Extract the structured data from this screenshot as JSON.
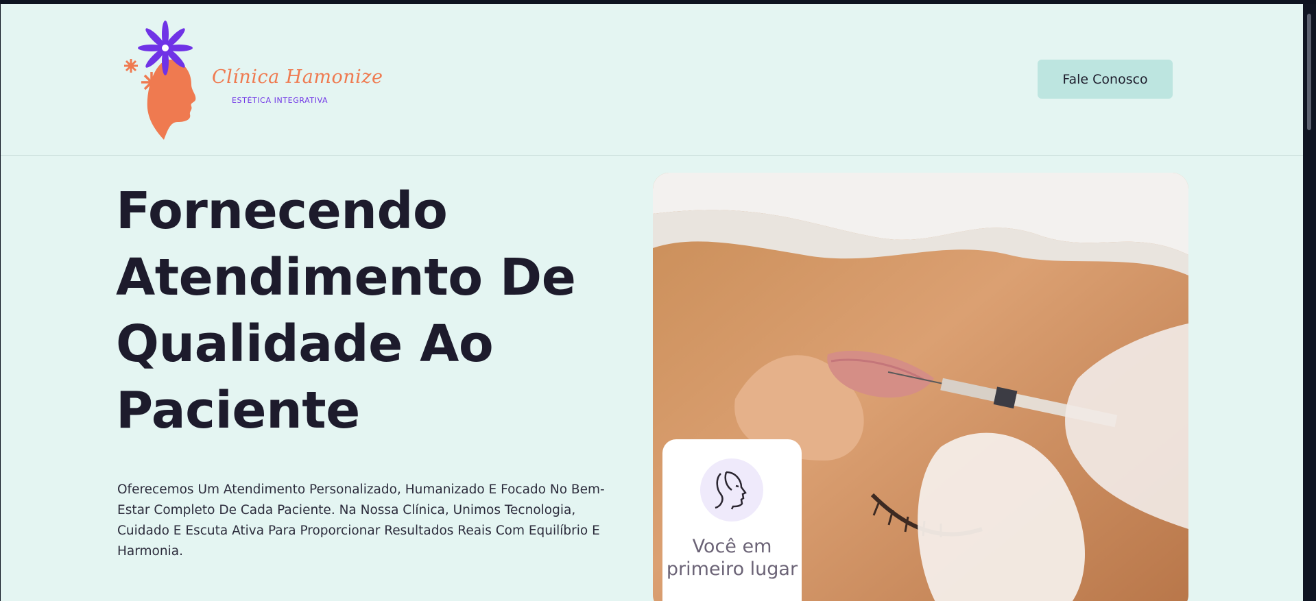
{
  "brand": {
    "name": "Clínica Hamonize",
    "tagline": "ESTÉTICA INTEGRATIVA"
  },
  "header": {
    "cta_label": "Fale Conosco"
  },
  "hero": {
    "title": "Fornecendo Atendimento De Qualidade Ao Paciente",
    "description": "Oferecemos Um Atendimento Personalizado, Humanizado E Focado No Bem-Estar Completo De Cada Paciente. Na Nossa Clínica, Unimos Tecnologia, Cuidado E Escuta Ativa Para Proporcionar Resultados Reais Com Equilíbrio E Harmonia.",
    "image_icon": "aesthetic-treatment-photo"
  },
  "feature_card": {
    "icon": "face-profile-icon",
    "label": "Você em primeiro lugar"
  },
  "colors": {
    "background": "#e4f5f2",
    "cta_background": "#bde5e0",
    "brand_orange": "#ef7a50",
    "brand_purple": "#6f33e6",
    "heading": "#1d1b2c"
  }
}
